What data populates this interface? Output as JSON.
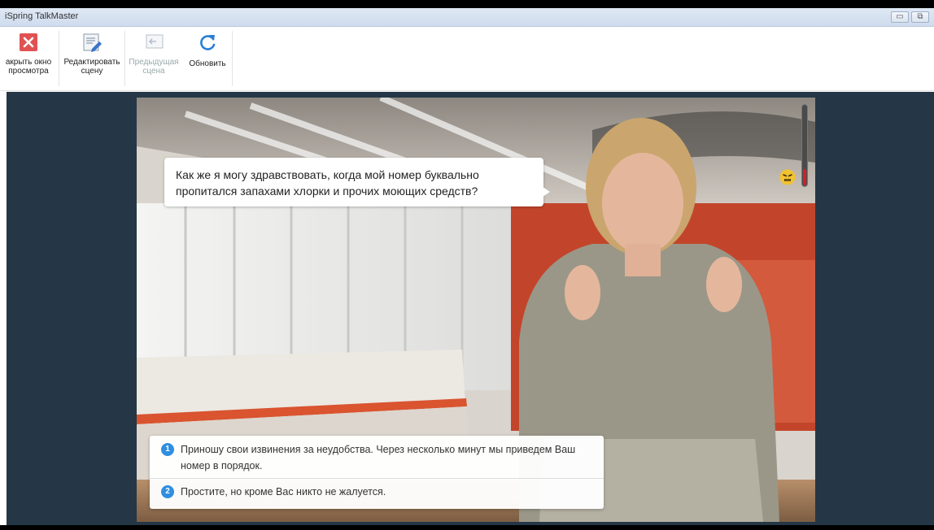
{
  "window": {
    "title": "iSpring TalkMaster"
  },
  "toolbar": {
    "close_label": "Закрыть окно просмотра",
    "close_label_line1": "акрыть окно",
    "close_label_line2": "просмотра",
    "edit_label_line1": "Редактировать",
    "edit_label_line2": "сцену",
    "prev_label_line1": "Предыдущая",
    "prev_label_line2": "сцена",
    "refresh_label": "Обновить"
  },
  "scene": {
    "character_line1": "Как же я могу здравствовать, когда мой номер буквально",
    "character_line2": "пропитался запахами хлорки и прочих моющих средств?",
    "emotion_icon": "angry-face-icon",
    "anger_level_percent": 20,
    "answers": [
      {
        "number": "1",
        "line1": "Приношу свои извинения за неудобства. Через несколько минут мы приведем Ваш",
        "line2": "номер в порядок."
      },
      {
        "number": "2",
        "line1": "Простите, но кроме Вас никто не жалуется."
      }
    ]
  },
  "colors": {
    "viewer_bg": "#253746",
    "answer_badge": "#2f8ee0",
    "meter_fill": "#d0202a",
    "close_button": "#e05252",
    "refresh_icon": "#2a7fd4"
  }
}
